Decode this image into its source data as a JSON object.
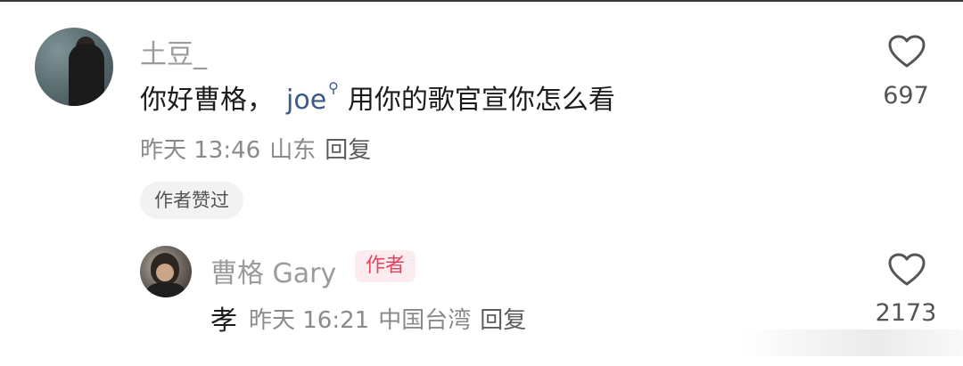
{
  "comment": {
    "username": "土豆_",
    "text_before": "你好曹格，",
    "mention": "joe",
    "text_after": "用你的歌官宣你怎么看",
    "time": "昨天 13:46",
    "location": "山东",
    "reply_label": "回复",
    "author_liked": "作者赞过",
    "likes": "697"
  },
  "reply": {
    "username": "曹格 Gary",
    "badge": "作者",
    "text": "孝",
    "time": "昨天 16:21",
    "location": "中国台湾",
    "reply_label": "回复",
    "likes": "2173"
  },
  "icons": {
    "like": "heart-outline-icon",
    "mention": "search-small-icon"
  },
  "colors": {
    "mention": "#3a5a86",
    "badge_text": "#e3445d",
    "badge_bg": "#fdecef",
    "muted": "#9b9b9b"
  }
}
